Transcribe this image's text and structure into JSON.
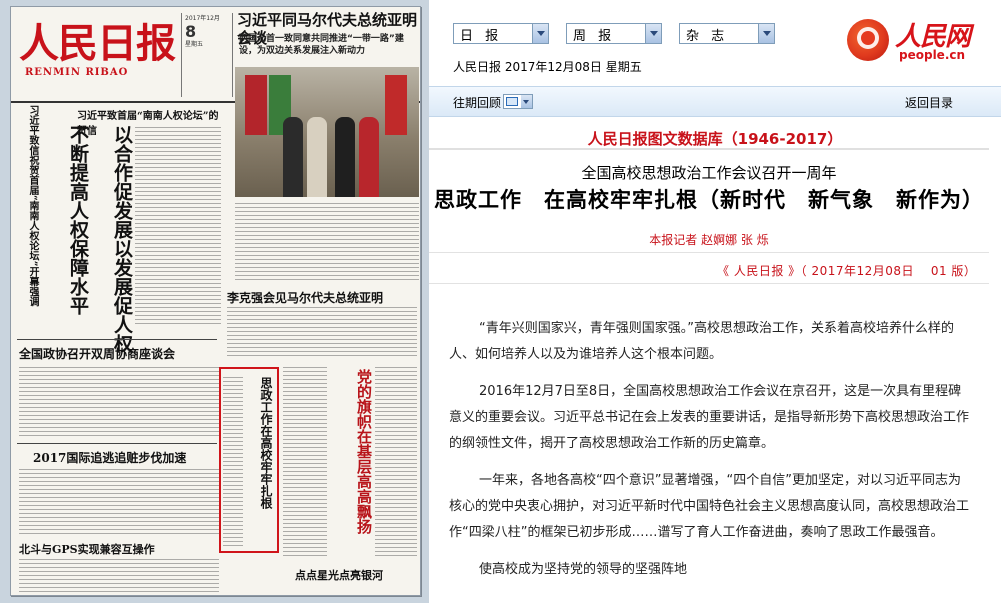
{
  "newspaper": {
    "logo": "人民日报",
    "logo_latin": "RENMIN RIBAO",
    "date_small": "2017年12月",
    "day_number": "8",
    "day_label": "星期五",
    "lead_headline": "习近平同马尔代夫总统亚明会谈",
    "lead_subheadline": "两国元首一致同意共同推进“一带一路”建设，为双边关系发展注入新动力",
    "vert_col_a": "习近平致信祝贺首届“南南人权论坛”开幕强调",
    "vert_col_b": "不断提高人权保障水平",
    "vert_col_c": "以合作促发展以发展促人权",
    "head_letter": "习近平致首届“南南人权论坛”的贺信",
    "head_li": "李克强会见马尔代夫总统亚明",
    "head_zx": "全国政协召开双周协商座谈会",
    "head_2017": "2017国际追逃追赃步伐加速",
    "head_gps": "北斗与GPS实现兼容互操作",
    "highlight_title": "思政工作在高校牢牢扎根",
    "bottom_banner": "点点星光点亮银河"
  },
  "toolbar": {
    "select_daily": "日 报",
    "select_weekly": "周 报",
    "select_magazine": "杂 志",
    "date_line": "人民日报 2017年12月08日 星期五"
  },
  "brand": {
    "logo_cn": "人民网",
    "logo_en": "people.cn",
    "accent_color": "#d7141a"
  },
  "nav": {
    "prev_issue": "往期回顾",
    "calendar_icon": "calendar-icon",
    "back_to_index": "返回目录"
  },
  "article": {
    "database_title": "人民日报图文数据库（1946-2017）",
    "kicker": "全国高校思想政治工作会议召开一周年",
    "headline": "思政工作　在高校牢牢扎根（新时代　新气象　新作为）",
    "byline": "本报记者  赵婀娜  张  烁",
    "source": "《 人民日报 》（ 2017年12月08日　 01 版）",
    "paragraphs": [
      "“青年兴则国家兴，青年强则国家强。”高校思想政治工作，关系着高校培养什么样的人、如何培养人以及为谁培养人这个根本问题。",
      "2016年12月7日至8日，全国高校思想政治工作会议在京召开，这是一次具有里程碑意义的重要会议。习近平总书记在会上发表的重要讲话，是指导新形势下高校思想政治工作的纲领性文件，揭开了高校思想政治工作新的历史篇章。",
      "一年来，各地各高校“四个意识”显著增强，“四个自信”更加坚定，对以习近平同志为核心的党中央衷心拥护，对习近平新时代中国特色社会主义思想高度认同，高校思想政治工作“四梁八柱”的框架已初步形成……谱写了育人工作奋进曲，奏响了思政工作最强音。",
      "使高校成为坚持党的领导的坚强阵地"
    ]
  }
}
